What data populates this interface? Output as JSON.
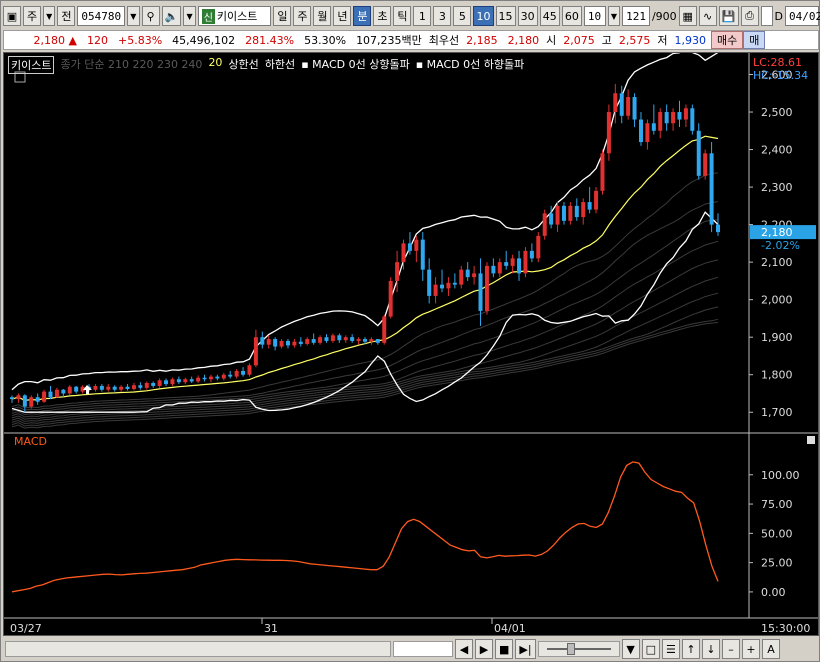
{
  "toolbar": {
    "type_label": "주",
    "all_label": "전",
    "code": "054780",
    "stock_sin": "신",
    "stock_name": "키이스트",
    "periods": [
      "일",
      "주",
      "월",
      "년",
      "분",
      "초",
      "틱"
    ],
    "active_period": "분",
    "minutes": [
      "1",
      "3",
      "5",
      "10",
      "15",
      "30",
      "45",
      "60"
    ],
    "active_minute": "10",
    "interval_value": "10",
    "count": "121",
    "count_total": "/900",
    "d_label": "D",
    "date_value": "04/02"
  },
  "quote": {
    "price": "2,180",
    "change": "120",
    "change_pct": "+5.83%",
    "volume": "45,496,102",
    "vol_ratio": "281.43%",
    "ratio2": "53.30%",
    "amount": "107,235백만",
    "best_label": "최우선",
    "best_ask": "2,185",
    "best_bid": "2,180",
    "open_label": "시",
    "open": "2,075",
    "high_label": "고",
    "high": "2,575",
    "low_label": "저",
    "low": "1,930",
    "sell_label": "매수",
    "more_label": "매"
  },
  "legend": {
    "name": "키이스트",
    "ma": "종가 단순 210  220  230  240",
    "ma20": "20",
    "items": [
      "상한선",
      "하한선",
      "MACD 0선 상향돌파",
      "MACD 0선 하향돌파"
    ]
  },
  "price_axis": {
    "ticks": [
      "2,600",
      "2,500",
      "2,400",
      "2,300",
      "2,200",
      "2,100",
      "2,000",
      "1,900",
      "1,800",
      "1,700"
    ],
    "lc": "LC:28.61",
    "hc": "HC:-15.34",
    "current": "2,180",
    "current_pct": "-2.02%"
  },
  "macd": {
    "label": "MACD",
    "ticks": [
      "100.00",
      "75.00",
      "50.00",
      "25.00",
      "0.00"
    ]
  },
  "time_axis": {
    "labels": [
      "03/27",
      "31",
      "04/01",
      "15:30:00"
    ]
  },
  "colors": {
    "up": "#e03030",
    "down": "#30a8f0",
    "ma20": "#ffff66",
    "band": "#ffffff",
    "macd": "#ff5a1e"
  },
  "chart_data": [
    {
      "type": "candlestick",
      "title": "",
      "ylim": [
        1650,
        2620
      ],
      "x_range": [
        "03/27",
        "04/02 15:30"
      ],
      "candles": [
        [
          1740,
          1745,
          1725,
          1735
        ],
        [
          1735,
          1750,
          1725,
          1745
        ],
        [
          1745,
          1748,
          1700,
          1715
        ],
        [
          1715,
          1745,
          1710,
          1740
        ],
        [
          1740,
          1750,
          1720,
          1728
        ],
        [
          1728,
          1760,
          1725,
          1755
        ],
        [
          1755,
          1770,
          1735,
          1740
        ],
        [
          1740,
          1765,
          1738,
          1760
        ],
        [
          1760,
          1762,
          1740,
          1750
        ],
        [
          1750,
          1772,
          1745,
          1768
        ],
        [
          1768,
          1770,
          1750,
          1755
        ],
        [
          1755,
          1772,
          1750,
          1768
        ],
        [
          1768,
          1775,
          1755,
          1760
        ],
        [
          1760,
          1775,
          1755,
          1770
        ],
        [
          1770,
          1775,
          1755,
          1760
        ],
        [
          1760,
          1775,
          1755,
          1768
        ],
        [
          1768,
          1772,
          1755,
          1760
        ],
        [
          1760,
          1772,
          1755,
          1768
        ],
        [
          1768,
          1775,
          1758,
          1762
        ],
        [
          1762,
          1778,
          1758,
          1772
        ],
        [
          1772,
          1780,
          1760,
          1765
        ],
        [
          1765,
          1782,
          1760,
          1778
        ],
        [
          1778,
          1782,
          1765,
          1770
        ],
        [
          1770,
          1790,
          1765,
          1785
        ],
        [
          1785,
          1790,
          1770,
          1775
        ],
        [
          1775,
          1792,
          1770,
          1788
        ],
        [
          1788,
          1795,
          1775,
          1780
        ],
        [
          1780,
          1792,
          1775,
          1788
        ],
        [
          1788,
          1795,
          1778,
          1782
        ],
        [
          1782,
          1798,
          1778,
          1792
        ],
        [
          1792,
          1800,
          1782,
          1788
        ],
        [
          1788,
          1800,
          1780,
          1795
        ],
        [
          1795,
          1800,
          1785,
          1790
        ],
        [
          1790,
          1805,
          1785,
          1800
        ],
        [
          1800,
          1810,
          1790,
          1795
        ],
        [
          1795,
          1815,
          1790,
          1810
        ],
        [
          1810,
          1820,
          1795,
          1800
        ],
        [
          1800,
          1830,
          1795,
          1825
        ],
        [
          1825,
          1920,
          1820,
          1900
        ],
        [
          1900,
          1915,
          1870,
          1880
        ],
        [
          1880,
          1905,
          1870,
          1895
        ],
        [
          1895,
          1900,
          1865,
          1875
        ],
        [
          1875,
          1895,
          1870,
          1890
        ],
        [
          1890,
          1895,
          1870,
          1878
        ],
        [
          1878,
          1895,
          1872,
          1888
        ],
        [
          1888,
          1900,
          1875,
          1882
        ],
        [
          1882,
          1900,
          1878,
          1895
        ],
        [
          1895,
          1910,
          1880,
          1885
        ],
        [
          1885,
          1905,
          1880,
          1900
        ],
        [
          1900,
          1908,
          1885,
          1890
        ],
        [
          1890,
          1910,
          1885,
          1905
        ],
        [
          1905,
          1910,
          1885,
          1892
        ],
        [
          1892,
          1905,
          1885,
          1900
        ],
        [
          1900,
          1908,
          1885,
          1890
        ],
        [
          1890,
          1900,
          1880,
          1895
        ],
        [
          1895,
          1900,
          1882,
          1888
        ],
        [
          1888,
          1900,
          1880,
          1895
        ],
        [
          1895,
          1895,
          1880,
          1885
        ],
        [
          1885,
          1960,
          1880,
          1955
        ],
        [
          1955,
          2060,
          1950,
          2050
        ],
        [
          2050,
          2130,
          2020,
          2100
        ],
        [
          2100,
          2160,
          2080,
          2150
        ],
        [
          2150,
          2180,
          2120,
          2130
        ],
        [
          2130,
          2170,
          2100,
          2160
        ],
        [
          2160,
          2180,
          2050,
          2080
        ],
        [
          2080,
          2110,
          1990,
          2010
        ],
        [
          2010,
          2060,
          1990,
          2040
        ],
        [
          2040,
          2080,
          2020,
          2030
        ],
        [
          2030,
          2060,
          2010,
          2045
        ],
        [
          2045,
          2070,
          2030,
          2040
        ],
        [
          2040,
          2090,
          2030,
          2080
        ],
        [
          2080,
          2100,
          2050,
          2060
        ],
        [
          2060,
          2090,
          2040,
          2070
        ],
        [
          2070,
          2110,
          1930,
          1970
        ],
        [
          1970,
          2100,
          1960,
          2090
        ],
        [
          2090,
          2110,
          2060,
          2070
        ],
        [
          2070,
          2110,
          2060,
          2100
        ],
        [
          2100,
          2130,
          2080,
          2090
        ],
        [
          2090,
          2120,
          2070,
          2110
        ],
        [
          2110,
          2130,
          2050,
          2070
        ],
        [
          2070,
          2140,
          2060,
          2130
        ],
        [
          2130,
          2150,
          2100,
          2110
        ],
        [
          2110,
          2180,
          2100,
          2170
        ],
        [
          2170,
          2240,
          2160,
          2230
        ],
        [
          2230,
          2250,
          2190,
          2200
        ],
        [
          2200,
          2260,
          2180,
          2250
        ],
        [
          2250,
          2260,
          2200,
          2210
        ],
        [
          2210,
          2260,
          2200,
          2250
        ],
        [
          2250,
          2270,
          2210,
          2220
        ],
        [
          2220,
          2270,
          2200,
          2260
        ],
        [
          2260,
          2300,
          2230,
          2240
        ],
        [
          2240,
          2300,
          2230,
          2290
        ],
        [
          2290,
          2400,
          2280,
          2390
        ],
        [
          2390,
          2520,
          2370,
          2500
        ],
        [
          2500,
          2575,
          2470,
          2550
        ],
        [
          2550,
          2570,
          2470,
          2490
        ],
        [
          2490,
          2560,
          2480,
          2540
        ],
        [
          2540,
          2550,
          2460,
          2480
        ],
        [
          2480,
          2500,
          2410,
          2420
        ],
        [
          2420,
          2480,
          2400,
          2470
        ],
        [
          2470,
          2520,
          2440,
          2450
        ],
        [
          2450,
          2510,
          2430,
          2500
        ],
        [
          2500,
          2520,
          2450,
          2470
        ],
        [
          2470,
          2510,
          2450,
          2500
        ],
        [
          2500,
          2530,
          2460,
          2480
        ],
        [
          2480,
          2520,
          2460,
          2510
        ],
        [
          2510,
          2520,
          2440,
          2450
        ],
        [
          2450,
          2470,
          2320,
          2330
        ],
        [
          2330,
          2400,
          2320,
          2390
        ],
        [
          2390,
          2420,
          2180,
          2200
        ],
        [
          2200,
          2230,
          2170,
          2180
        ]
      ]
    },
    {
      "type": "line",
      "title": "MACD",
      "ylim": [
        -18,
        122
      ],
      "series": [
        {
          "name": "MACD",
          "values": [
            0,
            1,
            2,
            3,
            5,
            6,
            8,
            10,
            11,
            12,
            12.5,
            13,
            13.5,
            14,
            14.5,
            15,
            15.2,
            14.8,
            14.5,
            15,
            15.5,
            15.8,
            16,
            16.5,
            17,
            17.5,
            18,
            18.5,
            19,
            20,
            21,
            23,
            24,
            25,
            26,
            27,
            27.5,
            27.8,
            27.6,
            27.4,
            27.3,
            27.2,
            27.1,
            27,
            27,
            26.8,
            26.5,
            26,
            25,
            24,
            23.5,
            23,
            22.5,
            22,
            21.5,
            21,
            20.5,
            20,
            19.5,
            19,
            19,
            22,
            30,
            42,
            54,
            60,
            62,
            60,
            56,
            52,
            48,
            44,
            40,
            38,
            36,
            35,
            35.5,
            30,
            29,
            30,
            31.2,
            30.5,
            30.8,
            31,
            31.3,
            31.5,
            30.6,
            32,
            35,
            40,
            46,
            51,
            55,
            58,
            58.5,
            56,
            55,
            58,
            68,
            82,
            98,
            108,
            111,
            110,
            102,
            96,
            93,
            90,
            88,
            86,
            85,
            80,
            76,
            60,
            40,
            22,
            9
          ]
        }
      ]
    }
  ]
}
